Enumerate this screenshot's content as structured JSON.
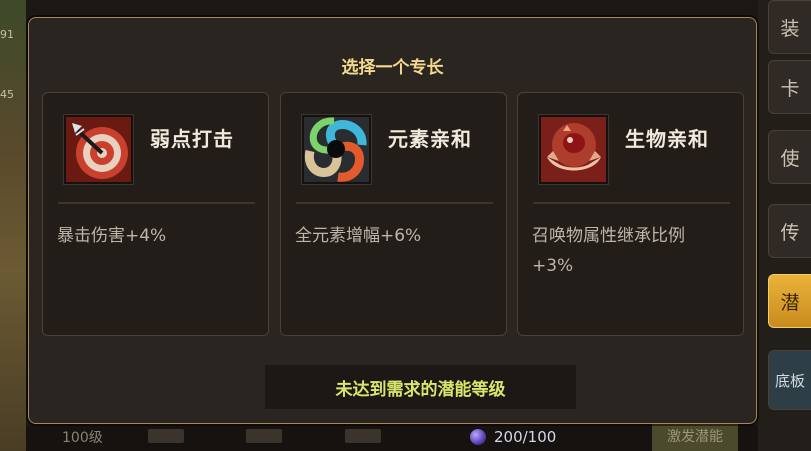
{
  "background": {
    "left_numbers": [
      "91",
      "45"
    ],
    "side_tabs": [
      "装",
      "卡",
      "使",
      "传",
      "潜",
      "底板"
    ],
    "level": "100级",
    "resource_value": "200/100",
    "activate_label": "激发潜能"
  },
  "modal": {
    "title": "选择一个专长",
    "status": "未达到需求的潜能等级",
    "cards": [
      {
        "name": "弱点打击",
        "icon": "target-arrow-icon",
        "desc": "暴击伤害+4%"
      },
      {
        "name": "元素亲和",
        "icon": "element-swirl-icon",
        "desc": "全元素增幅+6%"
      },
      {
        "name": "生物亲和",
        "icon": "hands-creature-icon",
        "desc": "召唤物属性继承比例\n+3%"
      }
    ]
  },
  "colors": {
    "title": "#f2d98d",
    "status": "#d8e66a",
    "frame_border": "#a8875a"
  }
}
